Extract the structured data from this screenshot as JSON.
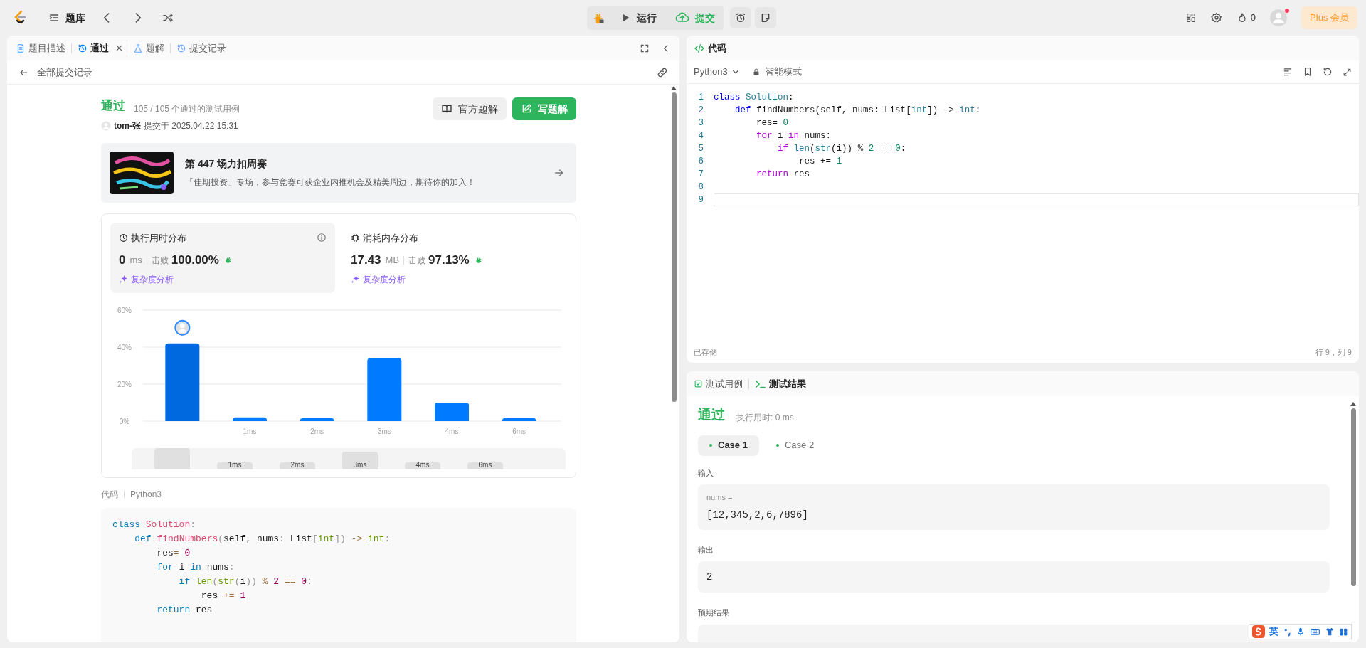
{
  "top_bar": {
    "problem_list": "题库",
    "run": "运行",
    "submit": "提交",
    "points": "0",
    "plus": "Plus 会员"
  },
  "left_panel": {
    "tabs": [
      {
        "label": "题目描述",
        "selected": false,
        "closable": false,
        "kind": "doc"
      },
      {
        "label": "通过",
        "selected": true,
        "closable": true,
        "kind": "history"
      },
      {
        "label": "题解",
        "selected": false,
        "closable": false,
        "kind": "flask"
      },
      {
        "label": "提交记录",
        "selected": false,
        "closable": false,
        "kind": "history"
      }
    ],
    "back_link": "全部提交记录",
    "submission": {
      "status": "通过",
      "cases": "105 / 105 个通过的测试用例",
      "user": "tom-张",
      "submitted": "提交于 2025.04.22 15:31",
      "official_button": "官方题解",
      "write_button": "写题解"
    },
    "banner": {
      "title": "第 447 场力扣周赛",
      "text": "「佳期投资」专场，参与竞赛可获企业内推机会及精美周边，期待你的加入！"
    },
    "stats": [
      {
        "kind": "time",
        "title": "执行用时分布",
        "value": "0",
        "unit": "ms",
        "beats_label": "击败",
        "beats": "100.00%",
        "analysis": "复杂度分析",
        "selected": true
      },
      {
        "kind": "memory",
        "title": "消耗内存分布",
        "value": "17.43",
        "unit": "MB",
        "beats_label": "击败",
        "beats": "97.13%",
        "analysis": "复杂度分析",
        "selected": false
      }
    ],
    "chart_data": {
      "type": "bar",
      "categories": [
        null,
        "1ms",
        "2ms",
        "3ms",
        "4ms",
        "6ms"
      ],
      "values": [
        42,
        2,
        1.5,
        34,
        10,
        1.5
      ],
      "ylim": [
        0,
        60
      ],
      "yticks": [
        {
          "value": 0,
          "label": "0%"
        },
        {
          "value": 20,
          "label": "20%"
        },
        {
          "value": 40,
          "label": "40%"
        },
        {
          "value": 60,
          "label": "60%"
        }
      ]
    },
    "chart_bars": [
      {
        "selected": true
      },
      {
        "selected": false
      },
      {
        "selected": false
      },
      {
        "selected": false
      },
      {
        "selected": false
      },
      {
        "selected": false
      }
    ],
    "overview_labels": [
      "1ms",
      "2ms",
      "3ms",
      "4ms",
      "6ms"
    ],
    "code_label": "代码",
    "code_language": "Python3",
    "code_lines": [
      {
        "tokens": [
          {
            "text": "class ",
            "kind": "keyword"
          },
          {
            "text": "Solution",
            "kind": "class"
          },
          {
            "text": ":",
            "kind": "punct"
          }
        ]
      },
      {
        "tokens": [
          {
            "text": "    def ",
            "kind": "keyword"
          },
          {
            "text": "findNumbers",
            "kind": "function"
          },
          {
            "text": "(",
            "kind": "punct"
          },
          {
            "text": "self",
            "kind": "plain"
          },
          {
            "text": ", ",
            "kind": "punct"
          },
          {
            "text": "nums",
            "kind": "plain"
          },
          {
            "text": ": ",
            "kind": "punct"
          },
          {
            "text": "List",
            "kind": "plain"
          },
          {
            "text": "[",
            "kind": "punct"
          },
          {
            "text": "int",
            "kind": "builtin"
          },
          {
            "text": "]",
            "kind": "punct"
          },
          {
            "text": ") ",
            "kind": "punct"
          },
          {
            "text": "->",
            "kind": "operator"
          },
          {
            "text": " int",
            "kind": "builtin"
          },
          {
            "text": ":",
            "kind": "punct"
          }
        ]
      },
      {
        "tokens": [
          {
            "text": "        res",
            "kind": "plain"
          },
          {
            "text": "= ",
            "kind": "operator"
          },
          {
            "text": "0",
            "kind": "number"
          }
        ]
      },
      {
        "tokens": [
          {
            "text": "        for",
            "kind": "flow"
          },
          {
            "text": " i ",
            "kind": "plain"
          },
          {
            "text": "in",
            "kind": "flow"
          },
          {
            "text": " nums",
            "kind": "plain"
          },
          {
            "text": ":",
            "kind": "punct"
          }
        ]
      },
      {
        "tokens": [
          {
            "text": "            if",
            "kind": "flow"
          },
          {
            "text": " len",
            "kind": "builtin"
          },
          {
            "text": "(",
            "kind": "punct"
          },
          {
            "text": "str",
            "kind": "builtin"
          },
          {
            "text": "(",
            "kind": "punct"
          },
          {
            "text": "i",
            "kind": "plain"
          },
          {
            "text": ")) ",
            "kind": "punct"
          },
          {
            "text": "%",
            "kind": "operator"
          },
          {
            "text": " 2",
            "kind": "number"
          },
          {
            "text": " ==",
            "kind": "operator"
          },
          {
            "text": " 0",
            "kind": "number"
          },
          {
            "text": ":",
            "kind": "punct"
          }
        ]
      },
      {
        "tokens": [
          {
            "text": "                res ",
            "kind": "plain"
          },
          {
            "text": "+=",
            "kind": "operator"
          },
          {
            "text": " 1",
            "kind": "number"
          }
        ]
      },
      {
        "tokens": [
          {
            "text": "        return",
            "kind": "flow"
          },
          {
            "text": " res",
            "kind": "plain"
          }
        ]
      }
    ]
  },
  "editor_panel": {
    "title": "代码",
    "language": "Python3",
    "mode": "智能模式",
    "lines": [
      {
        "number": "1",
        "current": false,
        "tokens": [
          {
            "text": "class ",
            "kind": "keyword"
          },
          {
            "text": "Solution",
            "kind": "class"
          },
          {
            "text": ":",
            "kind": "punct"
          }
        ]
      },
      {
        "number": "2",
        "current": false,
        "tokens": [
          {
            "text": "    def ",
            "kind": "keyword"
          },
          {
            "text": "findNumbers",
            "kind": "function"
          },
          {
            "text": "(",
            "kind": "punct"
          },
          {
            "text": "self",
            "kind": "plain"
          },
          {
            "text": ", ",
            "kind": "punct"
          },
          {
            "text": "nums",
            "kind": "plain"
          },
          {
            "text": ": ",
            "kind": "punct"
          },
          {
            "text": "List",
            "kind": "plain"
          },
          {
            "text": "[",
            "kind": "punct"
          },
          {
            "text": "int",
            "kind": "builtin"
          },
          {
            "text": "]",
            "kind": "punct"
          },
          {
            "text": ") ",
            "kind": "punct"
          },
          {
            "text": "->",
            "kind": "operator"
          },
          {
            "text": " int",
            "kind": "builtin"
          },
          {
            "text": ":",
            "kind": "punct"
          }
        ]
      },
      {
        "number": "3",
        "current": false,
        "tokens": [
          {
            "text": "        res",
            "kind": "plain"
          },
          {
            "text": "= ",
            "kind": "operator"
          },
          {
            "text": "0",
            "kind": "number"
          }
        ]
      },
      {
        "number": "4",
        "current": false,
        "tokens": [
          {
            "text": "        for",
            "kind": "flow"
          },
          {
            "text": " i ",
            "kind": "plain"
          },
          {
            "text": "in",
            "kind": "flow"
          },
          {
            "text": " nums",
            "kind": "plain"
          },
          {
            "text": ":",
            "kind": "punct"
          }
        ]
      },
      {
        "number": "5",
        "current": false,
        "tokens": [
          {
            "text": "            if",
            "kind": "flow"
          },
          {
            "text": " len",
            "kind": "builtin"
          },
          {
            "text": "(",
            "kind": "punct"
          },
          {
            "text": "str",
            "kind": "builtin"
          },
          {
            "text": "(",
            "kind": "punct"
          },
          {
            "text": "i",
            "kind": "plain"
          },
          {
            "text": ")) ",
            "kind": "punct"
          },
          {
            "text": "%",
            "kind": "operator"
          },
          {
            "text": " 2",
            "kind": "number"
          },
          {
            "text": " ==",
            "kind": "operator"
          },
          {
            "text": " 0",
            "kind": "number"
          },
          {
            "text": ":",
            "kind": "punct"
          }
        ]
      },
      {
        "number": "6",
        "current": false,
        "tokens": [
          {
            "text": "                res ",
            "kind": "plain"
          },
          {
            "text": "+=",
            "kind": "operator"
          },
          {
            "text": " 1",
            "kind": "number"
          }
        ]
      },
      {
        "number": "7",
        "current": false,
        "tokens": [
          {
            "text": "        return",
            "kind": "flow"
          },
          {
            "text": " res",
            "kind": "plain"
          }
        ]
      },
      {
        "number": "8",
        "current": false
      },
      {
        "number": "9",
        "current": true
      }
    ],
    "saved": "已存储",
    "cursor": "行 9，列 9"
  },
  "result_panel": {
    "tabs": [
      {
        "label": "测试用例",
        "selected": false,
        "kind": "check"
      },
      {
        "label": "测试结果",
        "selected": true,
        "kind": "terminal"
      }
    ],
    "status": "通过",
    "runtime": "执行用时: 0 ms",
    "cases": [
      {
        "label": "Case 1",
        "selected": true
      },
      {
        "label": "Case 2",
        "selected": false
      }
    ],
    "input_label": "输入",
    "inputs": [
      {
        "name": "nums =",
        "value": "[12,345,2,6,7896]"
      }
    ],
    "output_label": "输出",
    "output": "2",
    "expected_label": "预期结果"
  },
  "ime_bar": {
    "mode": "英"
  }
}
